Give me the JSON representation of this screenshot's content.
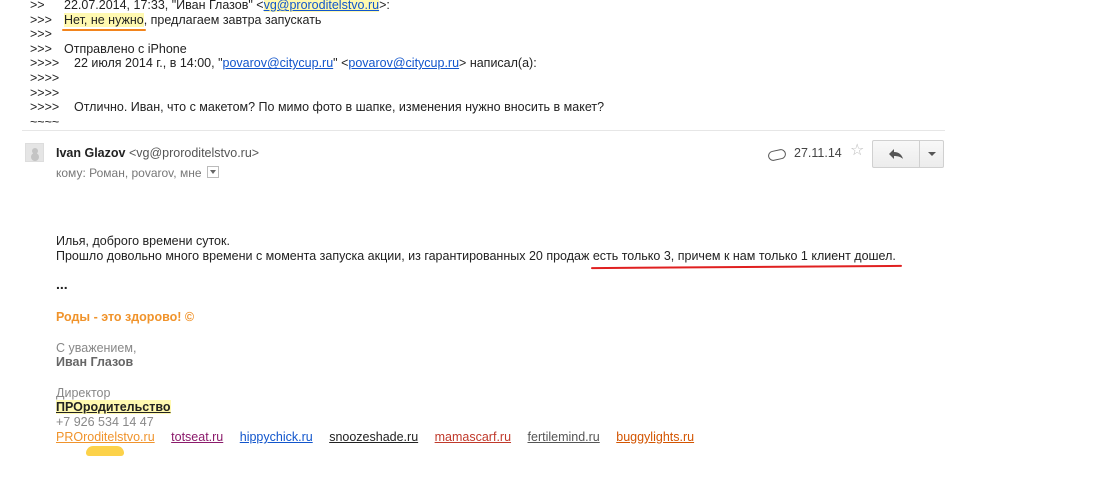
{
  "quoted": {
    "lines": [
      {
        "prefix": ">>",
        "pre": "22.07.2014, 17:33, \"Иван Глазов\" <",
        "link": "vg@proroditelstvo.ru",
        "post": ">:"
      },
      {
        "prefix": ">>>",
        "highlight": "Нет, не нужно",
        "rest": ", предлагаем завтра запускать"
      },
      {
        "prefix": ">>>",
        "text": ""
      },
      {
        "prefix": ">>>",
        "text": "Отправлено с iPhone"
      },
      {
        "prefix": ">>>>",
        "pre": "22 июля 2014 г., в 14:00, \"",
        "link1": "povarov@citycup.ru",
        "mid": "\" <",
        "link2": "povarov@citycup.ru",
        "post": "> написал(а):"
      },
      {
        "prefix": ">>>>",
        "text": ""
      },
      {
        "prefix": ">>>>",
        "text": ""
      },
      {
        "prefix": ">>>>",
        "text": "Отлично. Иван, что с макетом? По мимо фото в шапке, изменения нужно вносить в макет?"
      },
      {
        "prefix": "~~~~",
        "text": ""
      }
    ]
  },
  "header": {
    "sender_name": "Ivan Glazov",
    "sender_email": "<vg@proroditelstvo.ru>",
    "recipients_label": "кому:",
    "recipients": "Роман, povarov, мне",
    "date": "27.11.14",
    "star_glyph": "☆"
  },
  "body": {
    "greeting": "Илья, доброго времени суток.",
    "line2_pre": "Прошло довольно много времени с момента запуска акции, из гарантированных 20 продаж ",
    "line2_underlined": "есть только 3, причем к нам только 1 клиент дошел.",
    "ellipsis": "..."
  },
  "signature": {
    "slogan": "Роды - это здорово! ©",
    "regards": "С уважением,",
    "name": "Иван Глазов",
    "role": "Директор",
    "company": "ПРОродительство",
    "phone": "+7 926 534 14 47",
    "sites": [
      {
        "label": "PROroditelstvo.ru",
        "color": "#f0932b"
      },
      {
        "label": "totseat.ru",
        "color": "#8b1a6b"
      },
      {
        "label": "hippychick.ru",
        "color": "#1155cc"
      },
      {
        "label": "snoozeshade.ru",
        "color": "#222222"
      },
      {
        "label": "mamascarf.ru",
        "color": "#c0392b"
      },
      {
        "label": "fertilemind.ru",
        "color": "#555555"
      },
      {
        "label": "buggylights.ru",
        "color": "#d35400"
      }
    ]
  }
}
